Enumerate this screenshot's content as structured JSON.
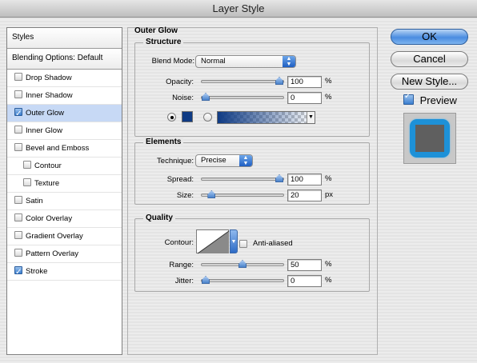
{
  "window": {
    "title": "Layer Style"
  },
  "styles_panel": {
    "header": "Styles",
    "blending_options": "Blending Options: Default",
    "items": [
      {
        "label": "Drop Shadow",
        "checked": false,
        "selected": false,
        "sub": false
      },
      {
        "label": "Inner Shadow",
        "checked": false,
        "selected": false,
        "sub": false
      },
      {
        "label": "Outer Glow",
        "checked": true,
        "selected": true,
        "sub": false
      },
      {
        "label": "Inner Glow",
        "checked": false,
        "selected": false,
        "sub": false
      },
      {
        "label": "Bevel and Emboss",
        "checked": false,
        "selected": false,
        "sub": false
      },
      {
        "label": "Contour",
        "checked": false,
        "selected": false,
        "sub": true
      },
      {
        "label": "Texture",
        "checked": false,
        "selected": false,
        "sub": true
      },
      {
        "label": "Satin",
        "checked": false,
        "selected": false,
        "sub": false
      },
      {
        "label": "Color Overlay",
        "checked": false,
        "selected": false,
        "sub": false
      },
      {
        "label": "Gradient Overlay",
        "checked": false,
        "selected": false,
        "sub": false
      },
      {
        "label": "Pattern Overlay",
        "checked": false,
        "selected": false,
        "sub": false
      },
      {
        "label": "Stroke",
        "checked": true,
        "selected": false,
        "sub": false
      }
    ]
  },
  "outer_glow": {
    "title": "Outer Glow",
    "structure": {
      "title": "Structure",
      "blend_mode_label": "Blend Mode:",
      "blend_mode_value": "Normal",
      "opacity_label": "Opacity:",
      "opacity_value": "100",
      "opacity_fraction": 1.0,
      "opacity_unit": "%",
      "noise_label": "Noise:",
      "noise_value": "0",
      "noise_fraction": 0.0,
      "noise_unit": "%",
      "glow_color": "#0f3b84"
    },
    "elements": {
      "title": "Elements",
      "technique_label": "Technique:",
      "technique_value": "Precise",
      "spread_label": "Spread:",
      "spread_value": "100",
      "spread_fraction": 1.0,
      "spread_unit": "%",
      "size_label": "Size:",
      "size_value": "20",
      "size_fraction": 0.08,
      "size_unit": "px"
    },
    "quality": {
      "title": "Quality",
      "contour_label": "Contour:",
      "anti_aliased_label": "Anti-aliased",
      "anti_aliased": false,
      "range_label": "Range:",
      "range_value": "50",
      "range_fraction": 0.5,
      "range_unit": "%",
      "jitter_label": "Jitter:",
      "jitter_value": "0",
      "jitter_fraction": 0.0,
      "jitter_unit": "%"
    }
  },
  "buttons": {
    "ok": "OK",
    "cancel": "Cancel",
    "new_style": "New Style...",
    "preview_label": "Preview",
    "preview_checked": true
  },
  "colors": {
    "preview_glow": "#1d91d8",
    "preview_fill": "#5f5f5f",
    "accent": "#3b7fd0"
  }
}
